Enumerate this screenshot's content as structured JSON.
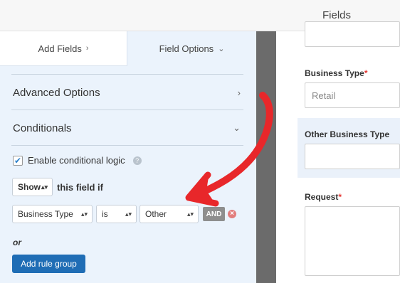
{
  "header": {
    "title": "Fields"
  },
  "tabs": [
    {
      "label": "Add Fields",
      "chevron": "chevron-right-icon"
    },
    {
      "label": "Field Options",
      "chevron": "chevron-down-icon"
    }
  ],
  "sections": {
    "advanced": {
      "label": "Advanced Options",
      "chevron": "chevron-right-icon"
    },
    "conditionals": {
      "label": "Conditionals",
      "chevron": "chevron-down-icon"
    }
  },
  "conditional": {
    "enable_label": "Enable conditional logic",
    "enabled": true,
    "action": "Show",
    "action_suffix": "this field if",
    "rule": {
      "field": "Business Type",
      "operator": "is",
      "value": "Other"
    },
    "and_label": "AND",
    "or_label": "or",
    "add_group_label": "Add rule group"
  },
  "preview": {
    "business_type_label": "Business Type",
    "business_type_placeholder": "Retail",
    "other_business_type_label": "Other Business Type",
    "request_label": "Request",
    "required_marker": "*"
  },
  "colors": {
    "accent": "#1f6db5",
    "panel_bg": "#ebf3fc",
    "arrow": "#e8272a",
    "required": "#e53935"
  }
}
